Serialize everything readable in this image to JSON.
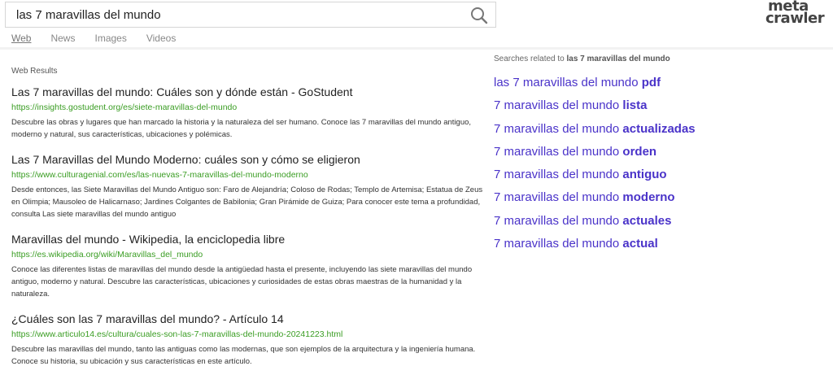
{
  "search": {
    "query": "las 7 maravillas del mundo",
    "placeholder": ""
  },
  "logo": {
    "line1": "meta",
    "line2": "crawler"
  },
  "tabs": [
    {
      "label": "Web",
      "active": true
    },
    {
      "label": "News",
      "active": false
    },
    {
      "label": "Images",
      "active": false
    },
    {
      "label": "Videos",
      "active": false
    }
  ],
  "results_label": "Web Results",
  "results": [
    {
      "title": "Las 7 maravillas del mundo: Cuáles son y dónde están - GoStudent",
      "url": "https://insights.gostudent.org/es/siete-maravillas-del-mundo",
      "desc": "Descubre las obras y lugares que han marcado la historia y la naturaleza del ser humano. Conoce las 7 maravillas del mundo antiguo, moderno y natural, sus características, ubicaciones y polémicas."
    },
    {
      "title": "Las 7 Maravillas del Mundo Moderno: cuáles son y cómo se eligieron",
      "url": "https://www.culturagenial.com/es/las-nuevas-7-maravillas-del-mundo-moderno",
      "desc": "Desde entonces, las Siete Maravillas del Mundo Antiguo son: Faro de Alejandría; Coloso de Rodas; Templo de Artemisa; Estatua de Zeus en Olimpia; Mausoleo de Halicarnaso; Jardines Colgantes de Babilonia; Gran Pirámide de Guiza; Para conocer este tema a profundidad, consulta Las siete maravillas del mundo antiguo"
    },
    {
      "title": "Maravillas del mundo - Wikipedia, la enciclopedia libre",
      "url": "https://es.wikipedia.org/wiki/Maravillas_del_mundo",
      "desc": "Conoce las diferentes listas de maravillas del mundo desde la antigüedad hasta el presente, incluyendo las siete maravillas del mundo antiguo, moderno y natural. Descubre las características, ubicaciones y curiosidades de estas obras maestras de la humanidad y la naturaleza."
    },
    {
      "title": "¿Cuáles son las 7 maravillas del mundo? - Artículo 14",
      "url": "https://www.articulo14.es/cultura/cuales-son-las-7-maravillas-del-mundo-20241223.html",
      "desc": "Descubre las maravillas del mundo, tanto las antiguas como las modernas, que son ejemplos de la arquitectura y la ingeniería humana. Conoce su historia, su ubicación y sus características en este artículo."
    }
  ],
  "related": {
    "heading_prefix": "Searches related to",
    "heading_query": "las 7 maravillas del mundo",
    "items": [
      {
        "plain": "las 7 maravillas del mundo ",
        "bold": "pdf"
      },
      {
        "plain": "7 maravillas del mundo ",
        "bold": "lista"
      },
      {
        "plain": "7 maravillas del mundo ",
        "bold": "actualizadas"
      },
      {
        "plain": "7 maravillas del mundo ",
        "bold": "orden"
      },
      {
        "plain": "7 maravillas del mundo ",
        "bold": "antiguo"
      },
      {
        "plain": "7 maravillas del mundo ",
        "bold": "moderno"
      },
      {
        "plain": "7 maravillas del mundo ",
        "bold": "actuales"
      },
      {
        "plain": "7 maravillas del mundo ",
        "bold": "actual"
      }
    ]
  },
  "colors": {
    "url_green": "#3a9d23",
    "related_link": "#4a33c9"
  },
  "icons": {
    "search": "search-icon"
  }
}
